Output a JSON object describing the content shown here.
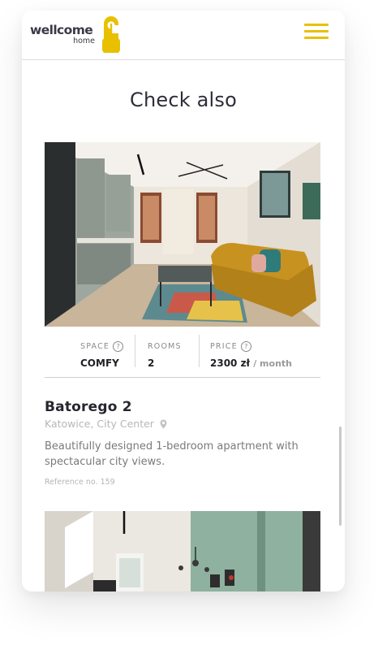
{
  "header": {
    "logo_main": "wellcome",
    "logo_sub": "home",
    "brand_color": "#E9C000",
    "menu_icon": "hamburger-menu-icon"
  },
  "section": {
    "title": "Check also"
  },
  "listings": [
    {
      "photo": "living-room-photo",
      "specs": {
        "space_label": "SPACE",
        "space_value": "COMFY",
        "rooms_label": "ROOMS",
        "rooms_value": "2",
        "price_label": "PRICE",
        "price_value": "2300 zł",
        "price_period": "/ month",
        "help_icon_text": "?"
      },
      "title": "Batorego 2",
      "location": "Katowice, City Center",
      "location_icon": "map-pin-icon",
      "description": "Beautifully designed 1-bedroom apartment with spectacular city views.",
      "reference": "Reference no. 159"
    },
    {
      "photo": "kitchen-photo"
    }
  ]
}
